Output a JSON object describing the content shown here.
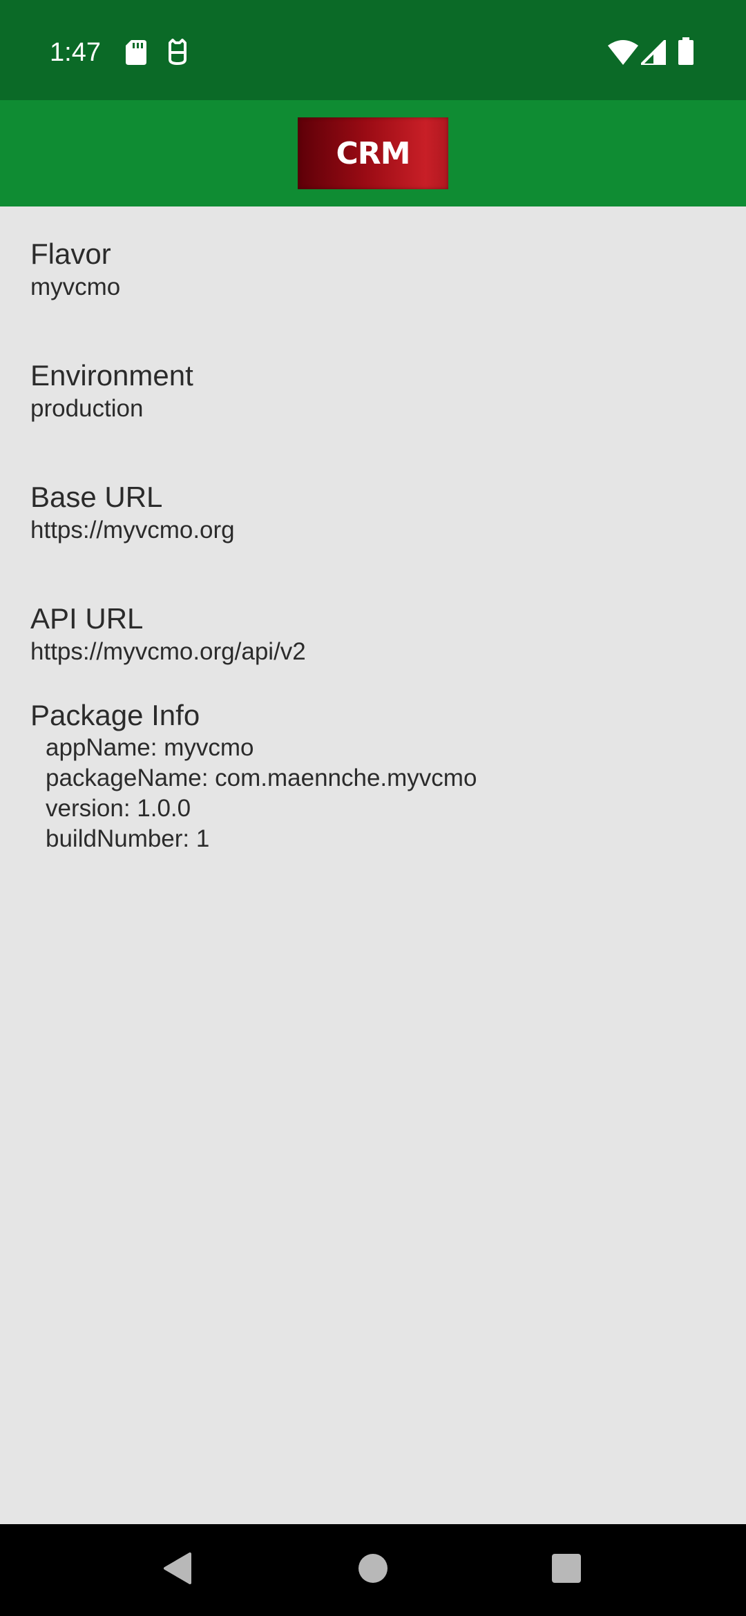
{
  "status_bar": {
    "time": "1:47",
    "left_icons": [
      "sd-card-icon",
      "cat-face-icon"
    ],
    "right_icons": [
      "wifi-icon",
      "signal-icon",
      "battery-icon"
    ]
  },
  "app_bar": {
    "logo_text": "CRM"
  },
  "fields": [
    {
      "label": "Flavor",
      "value": "myvcmo"
    },
    {
      "label": "Environment",
      "value": "production"
    },
    {
      "label": "Base URL",
      "value": "https://myvcmo.org"
    },
    {
      "label": "API URL",
      "value": "https://myvcmo.org/api/v2"
    }
  ],
  "package_info": {
    "label": "Package Info",
    "lines": [
      "appName: myvcmo",
      "packageName: com.maennche.myvcmo",
      "version: 1.0.0",
      "buildNumber: 1"
    ]
  },
  "nav_bar": {
    "buttons": [
      "back-icon",
      "home-icon",
      "recents-icon"
    ]
  },
  "colors": {
    "status_bar": "#0b6a27",
    "app_bar": "#0f8c33",
    "background": "#e5e5e5",
    "logo": "#9a0b14"
  }
}
